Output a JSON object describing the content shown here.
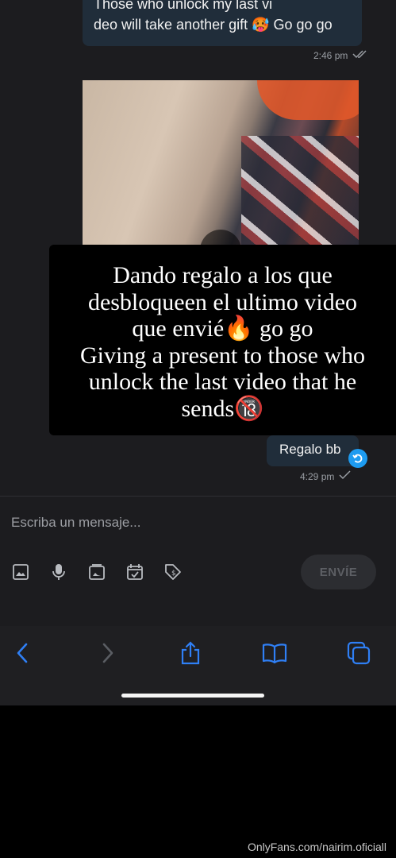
{
  "messages": {
    "first": {
      "line1": "Those who unlock my last vi",
      "line2": "deo will take another gift 🥵 Go go go",
      "time": "2:46 pm"
    },
    "reply": {
      "text": "Regalo bb",
      "time": "4:29 pm"
    }
  },
  "caption": {
    "lines": [
      "Dando regalo a los que",
      "desbloqueen el ultimo video",
      "que envié🔥 go go",
      "Giving a present to those who",
      "unlock the last video that he",
      "sends🔞"
    ]
  },
  "composer": {
    "placeholder": "Escriba un mensaje...",
    "send_label": "ENVÍE",
    "tools": [
      "image-icon",
      "microphone-icon",
      "media-vault-icon",
      "calendar-icon",
      "price-tag-icon"
    ]
  },
  "browser": {
    "buttons": [
      "back-icon",
      "forward-icon",
      "share-icon",
      "bookmarks-icon",
      "tabs-icon"
    ]
  },
  "watermark": "OnlyFans.com/nairim.oficiall",
  "colors": {
    "bubble": "#202d3a",
    "accent": "#1d9bf0",
    "background": "#1c1c1f"
  }
}
